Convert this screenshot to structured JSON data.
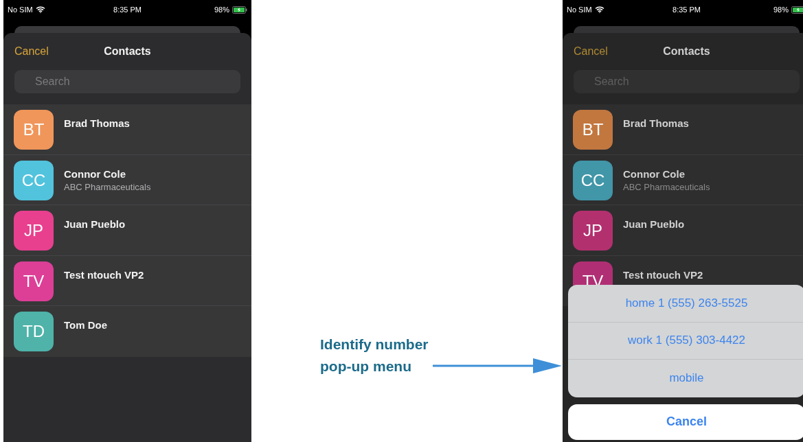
{
  "left_phone": {
    "dimmed": false,
    "status": {
      "carrier": "No SIM",
      "time": "8:35 PM",
      "battery": "98%"
    },
    "header": {
      "cancel": "Cancel",
      "title": "Contacts"
    },
    "search": {
      "placeholder": "Search"
    },
    "contacts": [
      {
        "initials": "BT",
        "name": "Brad Thomas",
        "color": "#f0965a"
      },
      {
        "initials": "CC",
        "name": "Connor Cole",
        "subtitle": "ABC Pharmaceuticals",
        "color": "#52c3dc"
      },
      {
        "initials": "JP",
        "name": "Juan Pueblo",
        "color": "#e8408f"
      },
      {
        "initials": "TV",
        "name": "Test ntouch VP2",
        "color": "#dd3f97"
      },
      {
        "initials": "TD",
        "name": "Tom Doe",
        "color": "#4fb3a9"
      }
    ]
  },
  "annotation": {
    "label": "Identify number pop-up menu"
  },
  "right_phone": {
    "dimmed": true,
    "status": {
      "carrier": "No SIM",
      "time": "8:35 PM",
      "battery": "98%"
    },
    "header": {
      "cancel": "Cancel",
      "title": "Contacts"
    },
    "search": {
      "placeholder": "Search"
    },
    "contacts": [
      {
        "initials": "BT",
        "name": "Brad Thomas",
        "color": "#c2773f"
      },
      {
        "initials": "CC",
        "name": "Connor Cole",
        "subtitle": "ABC Pharmaceuticals",
        "color": "#4196a8"
      },
      {
        "initials": "JP",
        "name": "Juan Pueblo",
        "color": "#b3306f"
      },
      {
        "initials": "TV",
        "name": "Test ntouch VP2",
        "color": "#b02f74"
      }
    ],
    "action_sheet": {
      "options": [
        "home 1 (555) 263-5525",
        "work 1 (555) 303-4422",
        "mobile"
      ],
      "cancel": "Cancel"
    }
  }
}
